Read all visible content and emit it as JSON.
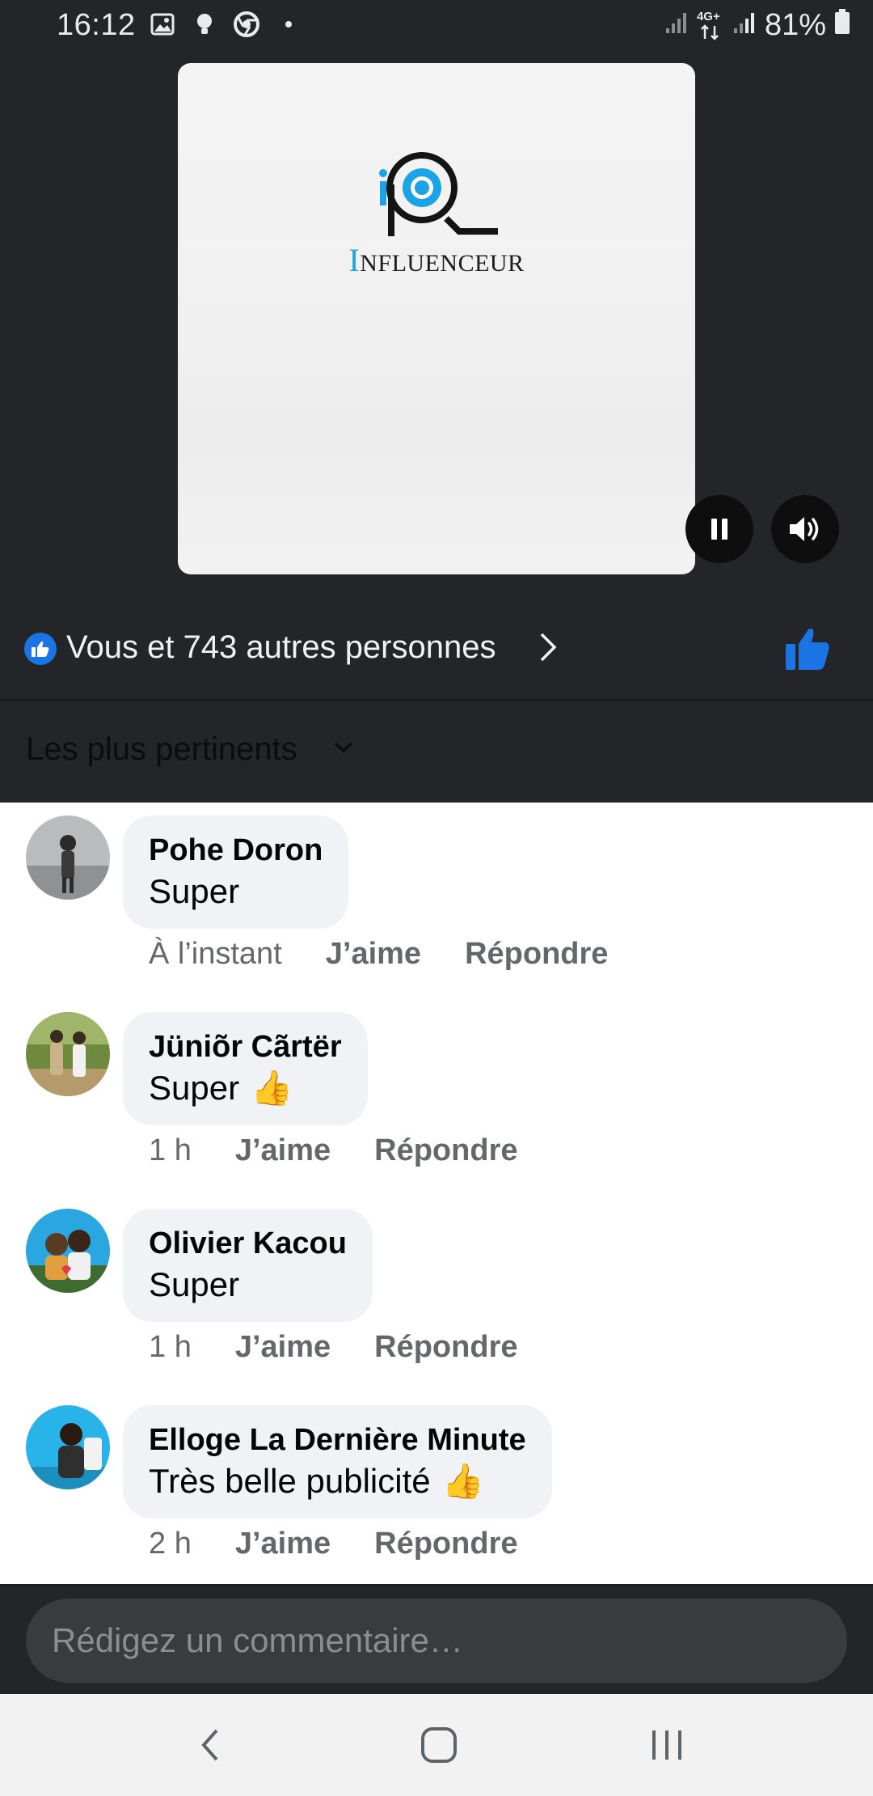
{
  "status_bar": {
    "time": "16:12",
    "network": "4G+",
    "battery": "81%",
    "icons": [
      "image-icon",
      "bulb-icon",
      "chrome-icon",
      "dot-icon",
      "signal-icon",
      "data-arrows-icon",
      "signal-icon",
      "battery-icon"
    ]
  },
  "video": {
    "brand_initial": "I",
    "brand_rest": "NFLUENCEUR",
    "controls": [
      "pause-icon",
      "volume-icon"
    ]
  },
  "reactions": {
    "text": "Vous et 743 autres personnes",
    "like_color": "#1b74e4"
  },
  "sort": {
    "label": "Les plus pertinents"
  },
  "comments": [
    {
      "name": "Pohe Doron",
      "text": "Super",
      "emoji": "",
      "time": "À l’instant",
      "like": "J’aime",
      "reply": "Répondre"
    },
    {
      "name": "Jüniõr Cãrtër",
      "text": "Super",
      "emoji": "👍",
      "time": "1 h",
      "like": "J’aime",
      "reply": "Répondre"
    },
    {
      "name": "Olivier Kacou",
      "text": "Super",
      "emoji": "",
      "time": "1 h",
      "like": "J’aime",
      "reply": "Répondre"
    },
    {
      "name": "Elloge La Dernière Minute",
      "text": "Très belle publicité",
      "emoji": "👍",
      "time": "2 h",
      "like": "J’aime",
      "reply": "Répondre"
    }
  ],
  "composer": {
    "placeholder": "Rédigez un commentaire…"
  },
  "nav": [
    "back-icon",
    "home-icon",
    "recents-icon"
  ]
}
